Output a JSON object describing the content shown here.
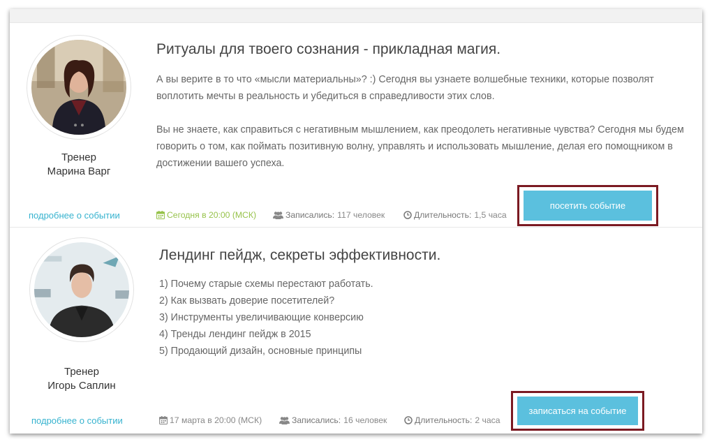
{
  "colors": {
    "accent": "#5bc0de",
    "link": "#37b3cf",
    "today": "#97c34b",
    "highlight_frame": "#7b1a22"
  },
  "events": [
    {
      "title": "Ритуалы для твоего сознания - прикладная магия.",
      "description": [
        "А вы верите в то что «мысли материальны»? :) Сегодня вы узнаете волшебные техники, которые позволят воплотить мечты в реальность и убедиться в справедливости этих слов.",
        "Вы не знаете, как справиться с негативным мышлением, как преодолеть негативные чувства? Сегодня мы будем говорить о том, как поймать позитивную волну, управлять и использовать мышление, делая его помощником в достижении вашего успеха."
      ],
      "trainer_role": "Тренер",
      "trainer_name": "Марина Варг",
      "more_link": "подробнее о событии",
      "date": "Сегодня в 20:00 (МСК)",
      "date_icon": "calendar-icon",
      "signed_label": "Записались:",
      "signed_value": "117 человек",
      "signed_icon": "users-icon",
      "duration_label": "Длительность:",
      "duration_value": "1,5 часа",
      "duration_icon": "clock-icon",
      "button": "посетить событие"
    },
    {
      "title": "Лендинг пейдж, секреты эффективности.",
      "description": [
        "1) Почему старые схемы перестают работать.",
        "2) Как вызвать доверие посетителей?",
        "3) Инструменты увеличивающие конверсию",
        "4) Тренды лендинг пейдж в 2015",
        "5) Продающий дизайн, основные принципы"
      ],
      "trainer_role": "Тренер",
      "trainer_name": "Игорь Саплин",
      "more_link": "подробнее о событии",
      "date": "17 марта в 20:00 (МСК)",
      "date_icon": "calendar-icon",
      "signed_label": "Записались:",
      "signed_value": "16 человек",
      "signed_icon": "users-icon",
      "duration_label": "Длительность:",
      "duration_value": "2 часа",
      "duration_icon": "clock-icon",
      "button": "записаться на событие"
    }
  ]
}
